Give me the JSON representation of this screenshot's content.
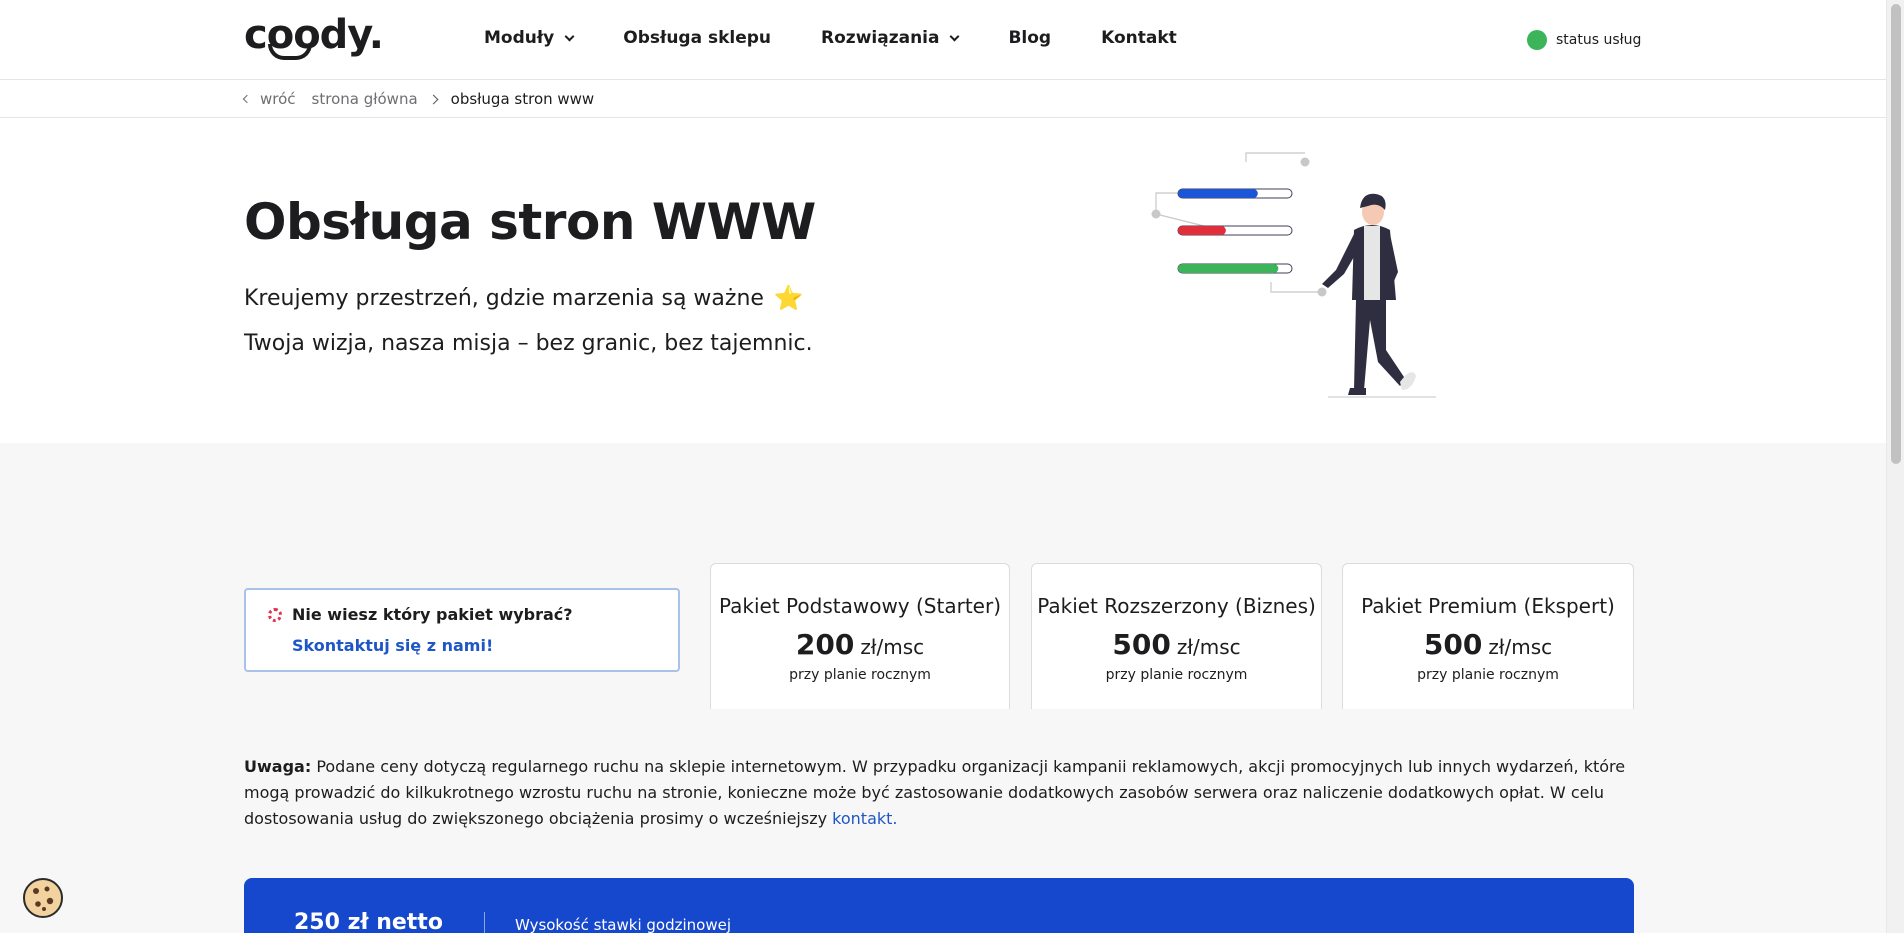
{
  "header": {
    "logo": "coody.",
    "nav": [
      {
        "label": "Moduły",
        "dropdown": true
      },
      {
        "label": "Obsługa sklepu",
        "dropdown": false
      },
      {
        "label": "Rozwiązania",
        "dropdown": true
      },
      {
        "label": "Blog",
        "dropdown": false
      },
      {
        "label": "Kontakt",
        "dropdown": false
      }
    ],
    "status_label": "status usług",
    "status_color": "#3cb55a"
  },
  "breadcrumb": {
    "back": "wróć",
    "home": "strona główna",
    "current": "obsługa stron www"
  },
  "hero": {
    "title": "Obsługa stron WWW",
    "line1": "Kreujemy przestrzeń, gdzie marzenia są ważne",
    "star_icon": "⭐",
    "line2": "Twoja wizja, nasza misja – bez granic, bez tajemnic."
  },
  "help": {
    "title": "Nie wiesz który pakiet wybrać?",
    "link": "Skontaktuj się z nami!"
  },
  "packages": [
    {
      "name": "Pakiet Podstawowy (Starter)",
      "price": "200",
      "unit": "zł/msc",
      "note": "przy planie rocznym"
    },
    {
      "name": "Pakiet Rozszerzony (Biznes)",
      "price": "500",
      "unit": "zł/msc",
      "note": "przy planie rocznym"
    },
    {
      "name": "Pakiet Premium (Ekspert)",
      "price": "500",
      "unit": "zł/msc",
      "note": "przy planie rocznym"
    }
  ],
  "note": {
    "label": "Uwaga:",
    "text": "Podane ceny dotyczą regularnego ruchu na sklepie internetowym. W przypadku organizacji kampanii reklamowych, akcji promocyjnych lub innych wydarzeń, które mogą prowadzić do kilkukrotnego wzrostu ruchu na stronie, konieczne może być zastosowanie dodatkowych zasobów serwera oraz naliczenie dodatkowych opłat. W celu dostosowania usług do zwiększonego obciążenia prosimy o wcześniejszy",
    "link": "kontakt."
  },
  "hourly": {
    "price": "250 zł netto",
    "label": "Wysokość stawki godzinowej"
  },
  "illustration": {
    "bars": [
      {
        "color": "#1a56d6",
        "fill": 0.7
      },
      {
        "color": "#e02f3a",
        "fill": 0.42
      },
      {
        "color": "#3cb55a",
        "fill": 0.88
      }
    ]
  },
  "colors": {
    "accent": "#1f56c7",
    "cta_bar": "#1648cd"
  }
}
